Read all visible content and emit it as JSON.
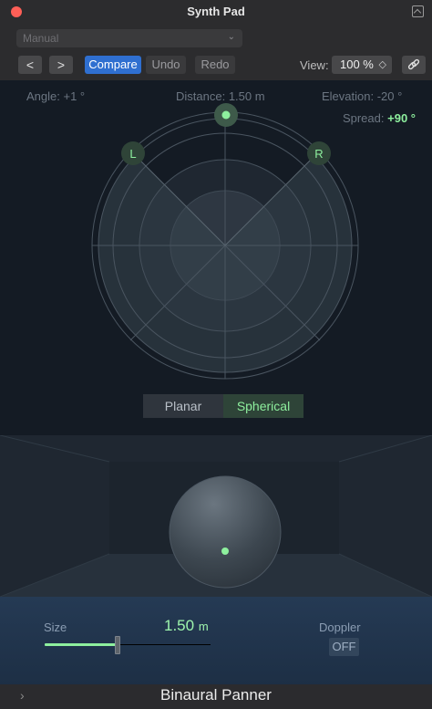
{
  "window": {
    "title": "Synth Pad"
  },
  "preset": {
    "value": "Manual"
  },
  "toolbar": {
    "prev_label": "<",
    "next_label": ">",
    "compare_label": "Compare",
    "undo_label": "Undo",
    "redo_label": "Redo",
    "view_label": "View:",
    "view_value": "100 %"
  },
  "panner": {
    "angle_label": "Angle:",
    "angle_value": "+1 °",
    "distance_label": "Distance:",
    "distance_value": "1.50 m",
    "elevation_label": "Elevation:",
    "elevation_value": "-20 °",
    "spread_label": "Spread:",
    "spread_value": "+90 °",
    "left_handle": "L",
    "right_handle": "R",
    "modes": [
      "Planar",
      "Spherical"
    ],
    "selected_mode": "Spherical"
  },
  "controls": {
    "size_label": "Size",
    "size_value": "1.50",
    "size_unit": "m",
    "size_fraction": 0.44,
    "doppler_label": "Doppler",
    "doppler_value": "OFF"
  },
  "footer": {
    "plugin_name": "Binaural Panner"
  },
  "colors": {
    "accent_green": "#8ef09e",
    "compare_blue": "#2f6fd0",
    "close_red": "#fe5f57"
  }
}
